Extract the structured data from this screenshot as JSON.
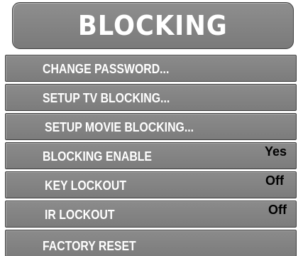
{
  "title": "BLOCKING",
  "menu": {
    "items": [
      {
        "label": "CHANGE PASSWORD...",
        "value": ""
      },
      {
        "label": "SETUP TV BLOCKING...",
        "value": ""
      },
      {
        "label": "SETUP MOVIE BLOCKING...",
        "value": ""
      },
      {
        "label": "BLOCKING ENABLE",
        "value": "Yes"
      },
      {
        "label": "KEY LOCKOUT",
        "value": "Off"
      },
      {
        "label": "IR LOCKOUT",
        "value": "Off"
      },
      {
        "label": "FACTORY RESET",
        "value": ""
      }
    ]
  },
  "colors": {
    "panel": "#858585",
    "border": "#3c3c3c",
    "label_text": "#ffffff",
    "value_text": "#000000"
  }
}
